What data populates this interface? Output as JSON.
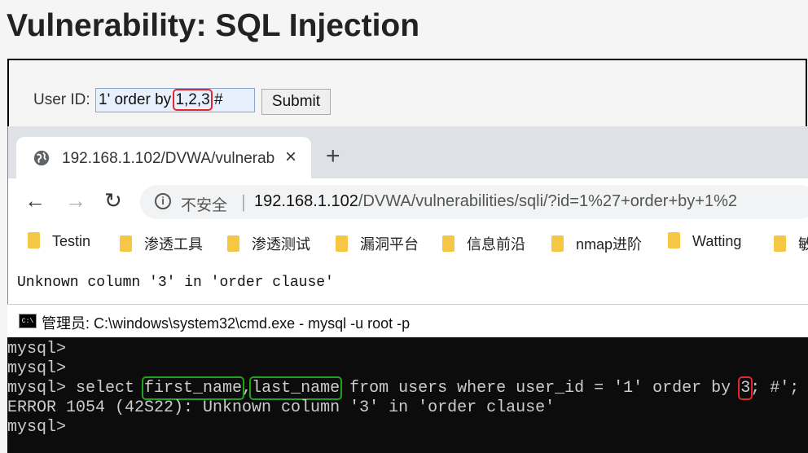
{
  "page": {
    "title": "Vulnerability: SQL Injection",
    "form": {
      "label": "User ID:",
      "input_prefix": "1' order by ",
      "input_highlight": "1,2,3",
      "input_suffix": " #",
      "submit_label": "Submit"
    }
  },
  "browser": {
    "tab": {
      "title": "192.168.1.102/DVWA/vulnerab",
      "close": "×",
      "new_tab": "+"
    },
    "nav": {
      "back": "←",
      "forward": "→",
      "reload": "↻"
    },
    "address": {
      "info": "i",
      "insecure_label": "不安全",
      "separator": "|",
      "host": "192.168.1.102",
      "path": "/DVWA/vulnerabilities/sqli/?id=1%27+order+by+1%2"
    },
    "bookmarks": [
      "Testin",
      "渗透工具",
      "渗透测试",
      "漏洞平台",
      "信息前沿",
      "nmap进阶",
      "Watting",
      "敏"
    ],
    "page_text": "Unknown column '3' in 'order clause'"
  },
  "cmd": {
    "icon_text": "C:\\",
    "title": "管理员: C:\\windows\\system32\\cmd.exe - mysql  -u root -p",
    "lines": {
      "l1": "mysql>",
      "l2": "mysql>",
      "l3_prompt": "mysql> select ",
      "l3_col1": "first_name",
      "l3_comma": ",",
      "l3_col2": "last_name",
      "l3_mid": " from users where user_id = '1' order by ",
      "l3_num": "3",
      "l3_end": "; #';",
      "l4": "ERROR 1054 (42S22): Unknown column '3' in 'order clause'",
      "l5": "mysql>"
    }
  }
}
